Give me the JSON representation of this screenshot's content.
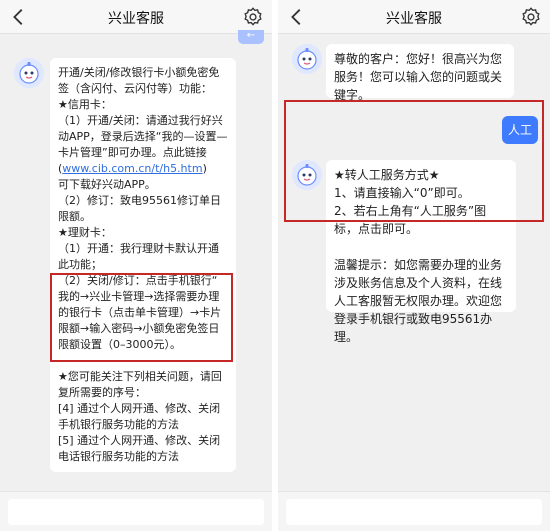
{
  "header": {
    "title": "兴业客服"
  },
  "left": {
    "cut_bubble_text": "←",
    "bot_message": {
      "lines": [
        "开通/关闭/修改银行卡小额免密免",
        "签（含闪付、云闪付等）功能：",
        "★信用卡：",
        "（1）开通/关闭：请通过我行好兴",
        "动APP，登录后选择“我的—设置—",
        "卡片管理”即可办理。点此链接",
        "(www.cib.com.cn/t/h5.htm)",
        "可下载好兴动APP。",
        "（2）修订：致电95561修订单日",
        "限额。",
        "★理财卡：",
        "（1）开通：我行理财卡默认开通",
        "此功能；",
        "（2）关闭/修订：点击手机银行“",
        "我的→兴业卡管理→选择需要办理",
        "的银行卡（点击单卡管理）→卡片",
        "限额→输入密码→小额免密免签日",
        "限额设置（0–3000元）。",
        "",
        "★您可能关注下列相关问题，请回",
        "复所需要的序号：",
        "[4] 通过个人网开通、修改、关闭",
        "手机银行服务功能的方法",
        "[5] 通过个人网开通、修改、关闭",
        "电话银行服务功能的方法"
      ],
      "link_text": "www.cib.com.cn/t/h5.htm"
    }
  },
  "right": {
    "bot_greeting": "尊敬的客户：您好！很高兴为您服务！您可以输入您的问题或关键字。",
    "user_message": "人工",
    "bot_reply": "★转人工服务方式★\n1、请直接输入“0”即可。\n2、若右上角有“人工服务”图标，点击即可。\n\n温馨提示：如您需要办理的业务涉及账务信息及个人资料，在线人工客服暂无权限办理。欢迎您登录手机银行或致电95561办理。"
  },
  "input": {
    "placeholder": ""
  },
  "colors": {
    "user_bubble": "#3f7bff",
    "highlight": "#c62828",
    "link": "#2f6fe0"
  }
}
